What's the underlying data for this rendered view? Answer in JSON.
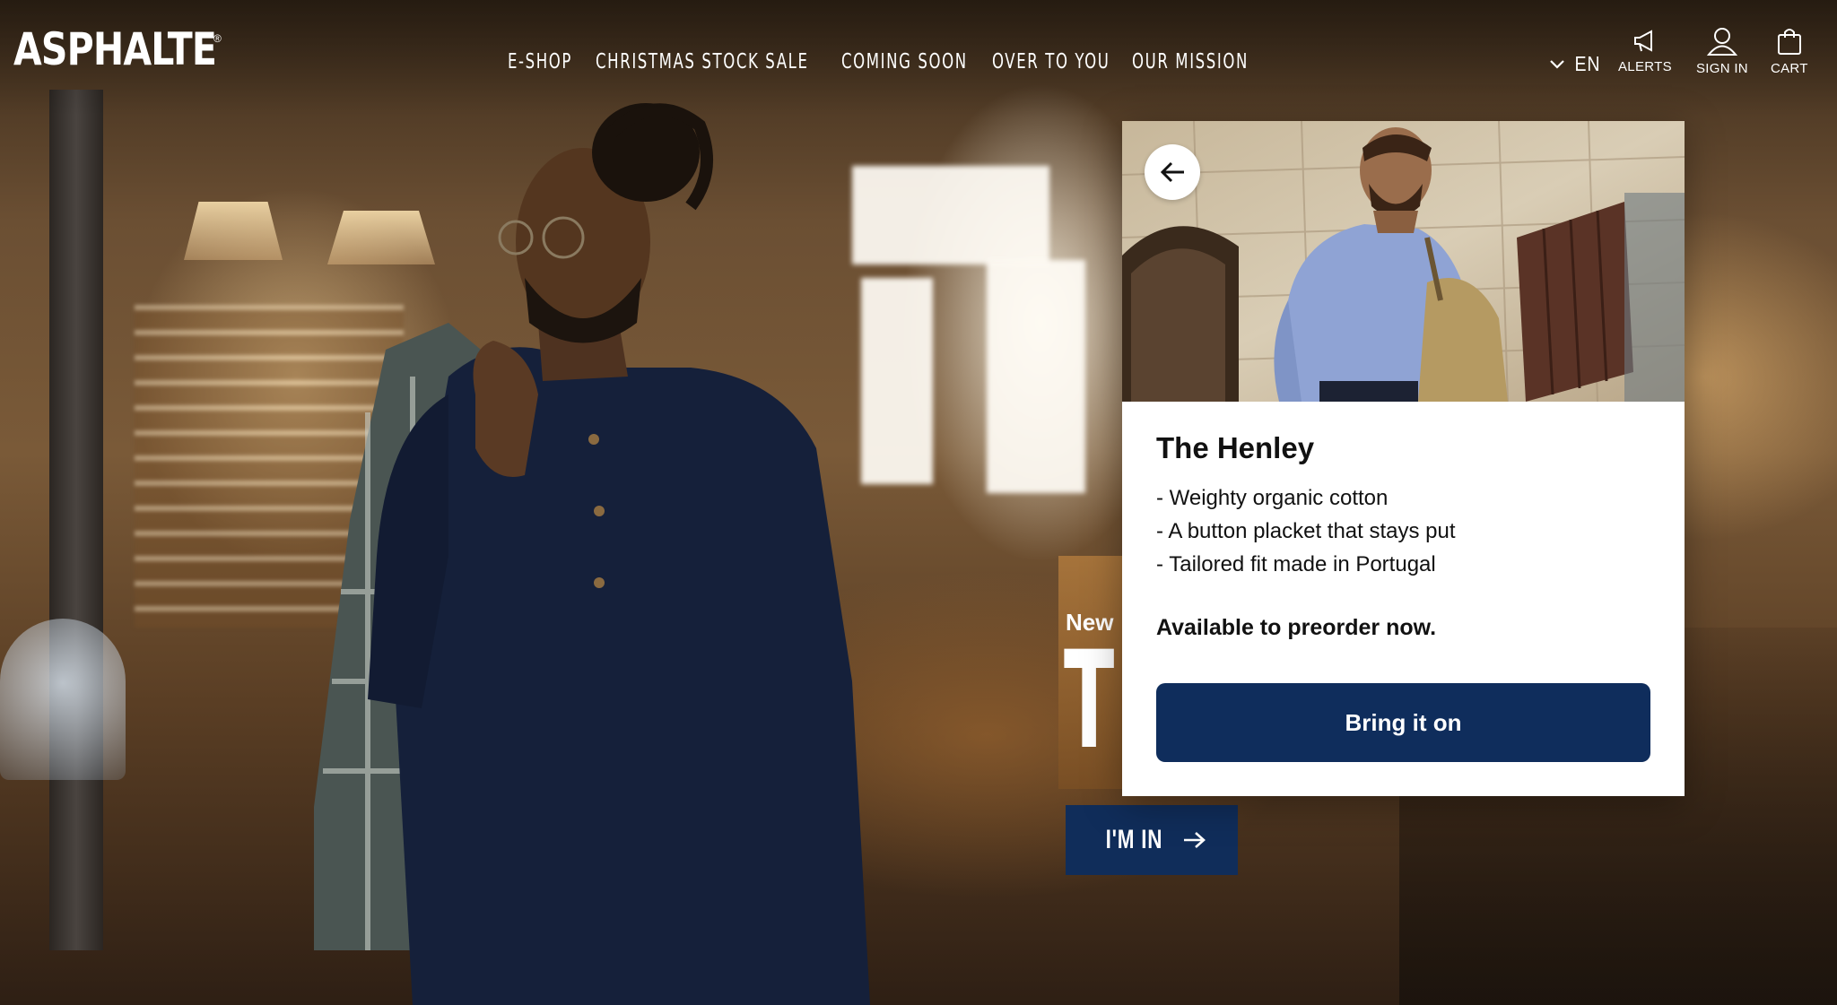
{
  "header": {
    "logo": "ASPHALTE",
    "logo_mark": "®",
    "nav": [
      {
        "label": "E-SHOP"
      },
      {
        "label": "CHRISTMAS STOCK SALE"
      },
      {
        "label": "COMING SOON"
      },
      {
        "label": "OVER TO YOU"
      },
      {
        "label": "OUR MISSION"
      }
    ],
    "language": "EN",
    "utilities": {
      "alerts": {
        "label": "ALERTS",
        "icon": "megaphone-icon"
      },
      "sign_in": {
        "label": "SIGN IN",
        "icon": "user-icon"
      },
      "cart": {
        "label": "CART",
        "icon": "shopping-bag-icon"
      }
    }
  },
  "hero": {
    "eyebrow": "New !",
    "title": "T",
    "cta_label": "I'M IN"
  },
  "popup": {
    "title": "The Henley",
    "features": [
      "- Weighty organic cotton",
      "- A button placket that stays put",
      "- Tailored fit made in Portugal"
    ],
    "availability": "Available to preorder now.",
    "cta_label": "Bring it on",
    "back_icon": "arrow-left-icon"
  },
  "colors": {
    "brand_navy": "#0f2d5c",
    "white": "#ffffff",
    "text_dark": "#111111"
  }
}
